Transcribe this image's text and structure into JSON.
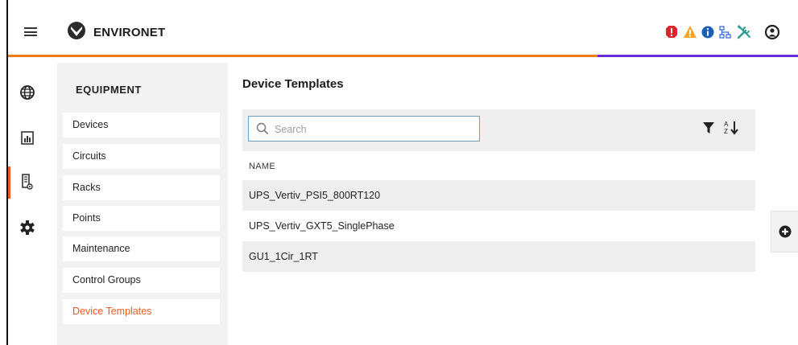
{
  "app": {
    "title": "ENVIRONET"
  },
  "toolbar_icons": [
    "alarm-critical-icon",
    "warning-icon",
    "info-icon",
    "network-icon",
    "tools-icon",
    "user-account-icon"
  ],
  "rail": {
    "items": [
      "globe-icon",
      "reports-icon",
      "equipment-icon",
      "settings-icon"
    ],
    "active": "equipment-icon"
  },
  "panel": {
    "title": "EQUIPMENT",
    "items": [
      {
        "label": "Devices"
      },
      {
        "label": "Circuits"
      },
      {
        "label": "Racks"
      },
      {
        "label": "Points"
      },
      {
        "label": "Maintenance"
      },
      {
        "label": "Control Groups"
      },
      {
        "label": "Device Templates"
      }
    ],
    "active_index": 6
  },
  "main": {
    "title": "Device Templates",
    "search": {
      "placeholder": "Search",
      "value": ""
    },
    "columns": [
      "NAME"
    ],
    "rows": [
      {
        "name": "UPS_Vertiv_PSI5_800RT120"
      },
      {
        "name": "UPS_Vertiv_GXT5_SinglePhase"
      },
      {
        "name": "GU1_1Cir_1RT"
      }
    ]
  },
  "colors": {
    "accent_orange": "#ee7d11",
    "accent_purple": "#6c2bd9",
    "active_text": "#ee5a24",
    "critical": "#d9262c",
    "warning": "#f5a623",
    "info": "#1a5fb4"
  }
}
